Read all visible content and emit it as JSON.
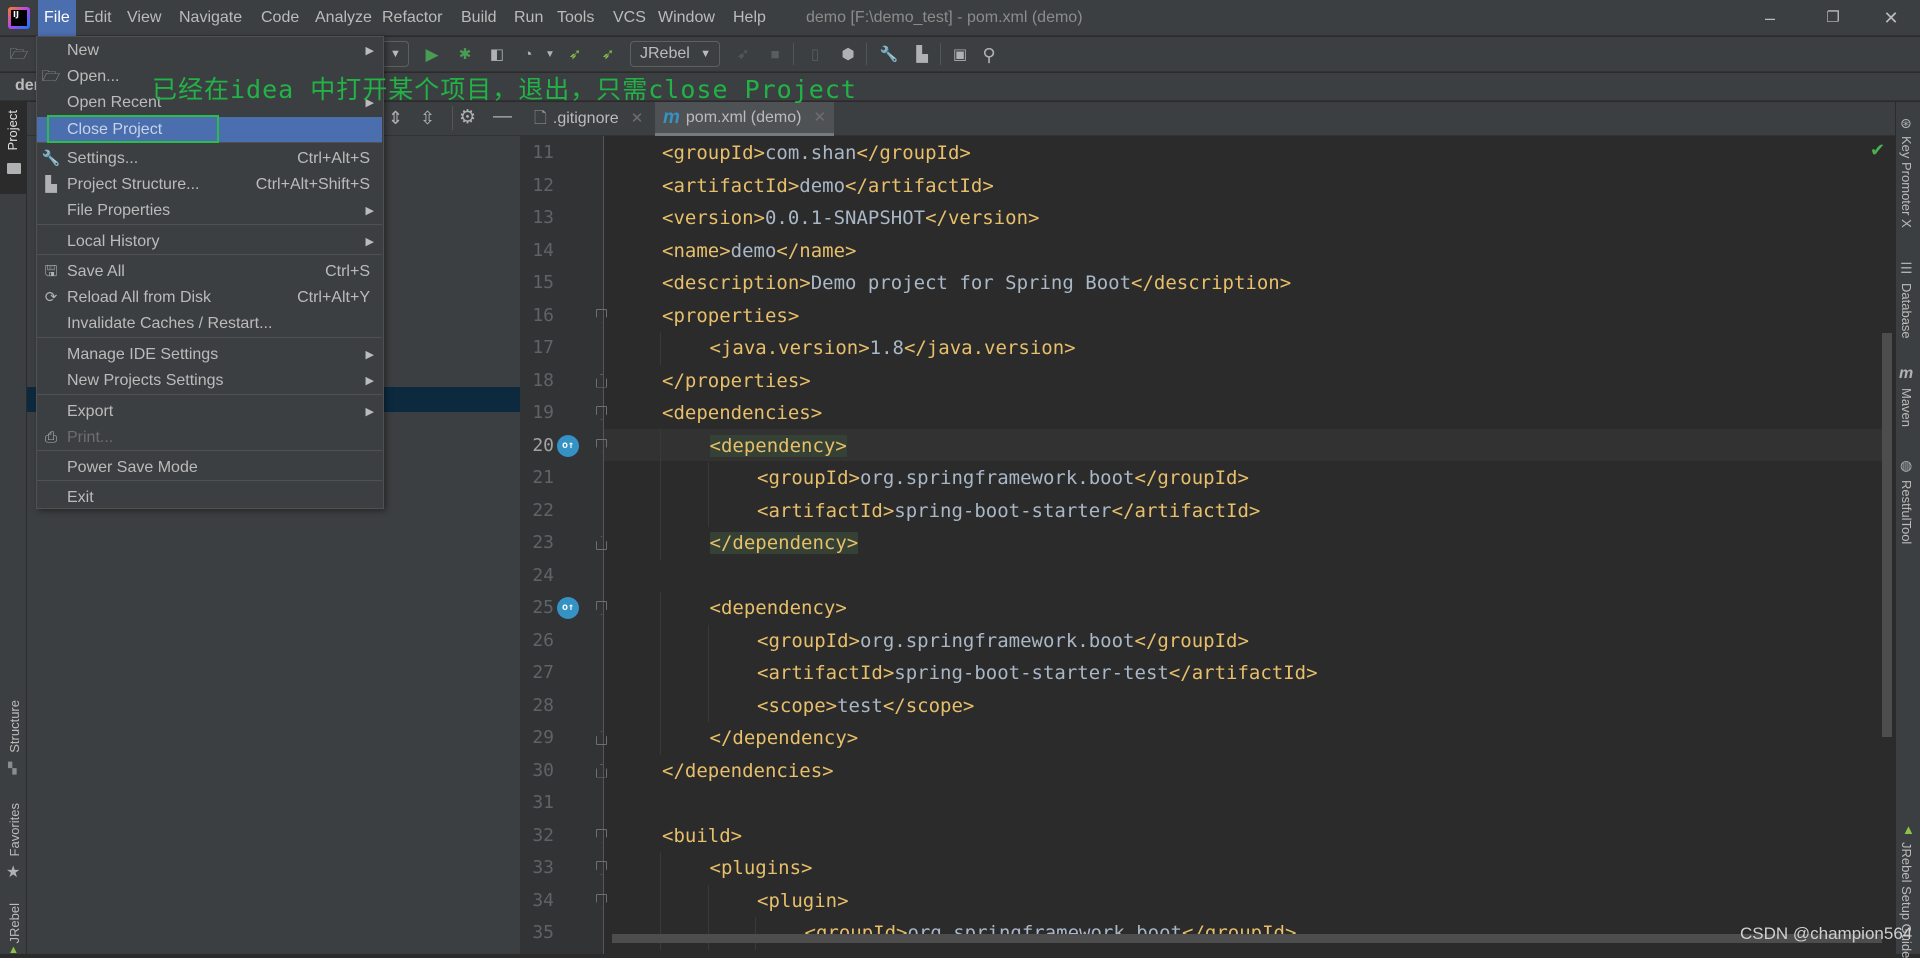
{
  "app": {
    "logo_text": "IJ",
    "window_title": "demo [F:\\demo_test] - pom.xml (demo)"
  },
  "menubar": {
    "items": [
      {
        "label": "File",
        "active": true
      },
      {
        "label": "Edit"
      },
      {
        "label": "View"
      },
      {
        "label": "Navigate"
      },
      {
        "label": "Code"
      },
      {
        "label": "Analyze"
      },
      {
        "label": "Refactor"
      },
      {
        "label": "Build"
      },
      {
        "label": "Run"
      },
      {
        "label": "Tools"
      },
      {
        "label": "VCS"
      },
      {
        "label": "Window"
      },
      {
        "label": "Help"
      }
    ],
    "window_controls": {
      "minimize": "–",
      "restore": "❐",
      "close": "✕"
    }
  },
  "toolbar": {
    "run_config": "JRebel",
    "icons": [
      "open-folder",
      "run",
      "debug",
      "coverage",
      "profile",
      "jrebel-run",
      "jrebel-debug",
      "jrebel-stop",
      "stop",
      "device",
      "build-artifacts",
      "settings",
      "project-structure",
      "terminal",
      "search"
    ]
  },
  "nav": {
    "breadcrumb": "demo"
  },
  "file_menu": {
    "items": [
      {
        "label": "New",
        "submenu": true
      },
      {
        "label": "Open...",
        "icon": "folder-open"
      },
      {
        "label": "Open Recent",
        "submenu": true
      },
      {
        "label": "Close Project",
        "selected": true
      },
      {
        "label": "Settings...",
        "shortcut": "Ctrl+Alt+S",
        "icon": "wrench"
      },
      {
        "label": "Project Structure...",
        "shortcut": "Ctrl+Alt+Shift+S",
        "icon": "project-structure"
      },
      {
        "label": "File Properties",
        "submenu": true
      },
      {
        "label": "Local History",
        "submenu": true
      },
      {
        "label": "Save All",
        "shortcut": "Ctrl+S",
        "icon": "save"
      },
      {
        "label": "Reload All from Disk",
        "shortcut": "Ctrl+Alt+Y",
        "icon": "reload"
      },
      {
        "label": "Invalidate Caches / Restart..."
      },
      {
        "label": "Manage IDE Settings",
        "submenu": true
      },
      {
        "label": "New Projects Settings",
        "submenu": true
      },
      {
        "label": "Export",
        "submenu": true
      },
      {
        "label": "Print...",
        "disabled": true,
        "icon": "printer"
      },
      {
        "label": "Power Save Mode"
      },
      {
        "label": "Exit"
      }
    ]
  },
  "annotation": "已经在idea 中打开某个项目，退出，只需close Project",
  "editor": {
    "tabs": [
      {
        "label": ".gitignore",
        "active": false
      },
      {
        "label": "pom.xml (demo)",
        "active": true
      }
    ],
    "current_line": 20,
    "lines": [
      {
        "n": 11,
        "indent": 1,
        "open": "<groupId>",
        "text": "com.shan",
        "close": "</groupId>"
      },
      {
        "n": 12,
        "indent": 1,
        "open": "<artifactId>",
        "text": "demo",
        "close": "</artifactId>"
      },
      {
        "n": 13,
        "indent": 1,
        "open": "<version>",
        "text": "0.0.1-SNAPSHOT",
        "close": "</version>"
      },
      {
        "n": 14,
        "indent": 1,
        "open": "<name>",
        "text": "demo",
        "close": "</name>"
      },
      {
        "n": 15,
        "indent": 1,
        "open": "<description>",
        "text": "Demo project for Spring Boot",
        "close": "</description>"
      },
      {
        "n": 16,
        "indent": 1,
        "open": "<properties>",
        "fold": "open"
      },
      {
        "n": 17,
        "indent": 2,
        "open": "<java.version>",
        "text": "1.8",
        "close": "</java.version>"
      },
      {
        "n": 18,
        "indent": 1,
        "open": "</properties>",
        "fold": "close"
      },
      {
        "n": 19,
        "indent": 1,
        "open": "<dependencies>",
        "fold": "open"
      },
      {
        "n": 20,
        "indent": 2,
        "open": "<dependency>",
        "fold": "open",
        "gutter_icon": true,
        "highlight": true
      },
      {
        "n": 21,
        "indent": 3,
        "open": "<groupId>",
        "text": "org.springframework.boot",
        "close": "</groupId>"
      },
      {
        "n": 22,
        "indent": 3,
        "open": "<artifactId>",
        "text": "spring-boot-starter",
        "close": "</artifactId>"
      },
      {
        "n": 23,
        "indent": 2,
        "open": "</dependency>",
        "fold": "close",
        "highlight": true
      },
      {
        "n": 24,
        "indent": 0
      },
      {
        "n": 25,
        "indent": 2,
        "open": "<dependency>",
        "fold": "open",
        "gutter_icon": true
      },
      {
        "n": 26,
        "indent": 3,
        "open": "<groupId>",
        "text": "org.springframework.boot",
        "close": "</groupId>"
      },
      {
        "n": 27,
        "indent": 3,
        "open": "<artifactId>",
        "text": "spring-boot-starter-test",
        "close": "</artifactId>"
      },
      {
        "n": 28,
        "indent": 3,
        "open": "<scope>",
        "text": "test",
        "close": "</scope>"
      },
      {
        "n": 29,
        "indent": 2,
        "open": "</dependency>",
        "fold": "close"
      },
      {
        "n": 30,
        "indent": 1,
        "open": "</dependencies>",
        "fold": "close"
      },
      {
        "n": 31,
        "indent": 0
      },
      {
        "n": 32,
        "indent": 1,
        "open": "<build>",
        "fold": "open"
      },
      {
        "n": 33,
        "indent": 2,
        "open": "<plugins>",
        "fold": "open"
      },
      {
        "n": 34,
        "indent": 3,
        "open": "<plugin>",
        "fold": "open"
      },
      {
        "n": 35,
        "indent": 4,
        "open": "<groupId>",
        "text": "org.springframework.boot",
        "close": "</groupId>"
      }
    ]
  },
  "left_tool_windows": [
    {
      "label": "Project",
      "icon": "folder",
      "active": true
    },
    {
      "label": "Structure",
      "icon": "structure"
    },
    {
      "label": "Favorites",
      "icon": "star"
    },
    {
      "label": "JRebel",
      "icon": "jrebel"
    }
  ],
  "right_tool_windows": [
    {
      "label": "Key Promoter X",
      "icon": "key-promoter"
    },
    {
      "label": "Database",
      "icon": "database"
    },
    {
      "label": "Maven",
      "icon": "maven"
    },
    {
      "label": "RestfulTool",
      "icon": "globe"
    },
    {
      "label": "JRebel Setup Guide",
      "icon": "jrebel"
    }
  ],
  "watermark": "CSDN @champion564"
}
